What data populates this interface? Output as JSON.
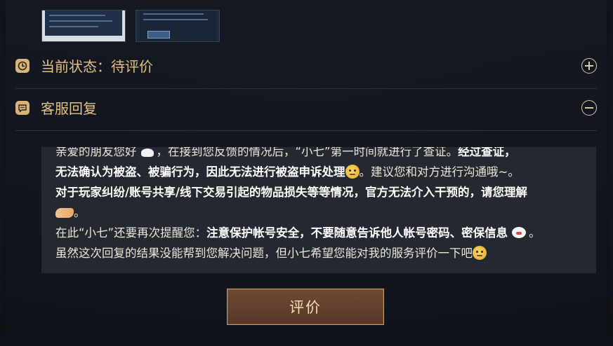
{
  "status": {
    "label": "当前状态：待评价",
    "icon": "clock-icon"
  },
  "reply_section": {
    "label": "客服回复",
    "icon": "chat-bubble-icon"
  },
  "reply": {
    "line1_normal": "亲爱的朋友您好",
    "line1_normal2": "，在接到您反馈的情况后，“小七”第一时间就进行了查证。",
    "line1_bold": "经过查证，",
    "line2_bold": "无法确认为被盗、被骗行为，因此无法进行被盗申诉处理",
    "line2_normal": "。建议您和对方进行沟通哦~。",
    "line3_bold": "对于玩家纠纷/账号共享/线下交易引起的物品损失等等情况，官方无法介入干预的，请您理解",
    "line4_normal": "。",
    "line5_normal": "在此“小七”还要再次提醒您：",
    "line5_bold": "注意保护帐号安全，不要随意告诉他人帐号密码、密保信息",
    "line5_end": "。",
    "line6_normal": "虽然这次回复的结果没能帮到您解决问题，但小七希望您能对我的服务评价一下吧"
  },
  "actions": {
    "rate_label": "评价"
  },
  "colors": {
    "accent": "#e3c184",
    "button_bg": "#6e4a35",
    "button_border": "#c49a5e"
  }
}
